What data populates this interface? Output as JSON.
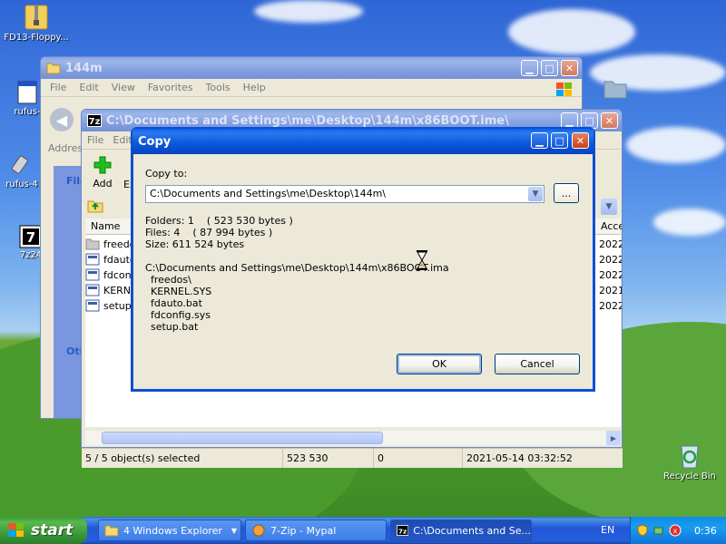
{
  "desktop_icons": {
    "floppy": "FD13-Floppy...",
    "rufus": "rufus-",
    "rufus4": "rufus-4",
    "sevenzip": "7z24",
    "recycle": "Recycle Bin"
  },
  "explorer": {
    "title": "144m",
    "menu": [
      "File",
      "Edit",
      "View",
      "Favorites",
      "Tools",
      "Help"
    ],
    "address_label": "Addres",
    "panel_file_label": "File",
    "panel_other_label": "Oth"
  },
  "sevenzip_window": {
    "title": "C:\\Documents and Settings\\me\\Desktop\\144m\\x86BOOT.ime\\",
    "menu": [
      "File",
      "Edit"
    ],
    "toolbar_add": "Add",
    "toolbar_extract": "Ex",
    "col_name": "Name",
    "col_accessed": "Acce",
    "rows": [
      {
        "name": "freedo",
        "date": "2022"
      },
      {
        "name": "fdauto",
        "date": "2022"
      },
      {
        "name": "fdconf",
        "date": "2022"
      },
      {
        "name": "KERNE",
        "date": "2021"
      },
      {
        "name": "setup",
        "date": "2022"
      }
    ],
    "status": {
      "selected": "5 / 5 object(s) selected",
      "size": "523 530",
      "packed": "0",
      "modified": "2021-05-14 03:32:52"
    }
  },
  "copy_dialog": {
    "title": "Copy",
    "copy_to_label": "Copy to:",
    "destination": "C:\\Documents and Settings\\me\\Desktop\\144m\\",
    "browse_label": "...",
    "folders": "Folders: 1    ( 523 530 bytes )",
    "files": "Files: 4    ( 87 994 bytes )",
    "size": "Size: 611 524 bytes",
    "source_path": "C:\\Documents and Settings\\me\\Desktop\\144m\\x86BOOT.ima",
    "items": [
      "freedos\\",
      "KERNEL.SYS",
      "fdauto.bat",
      "fdconfig.sys",
      "setup.bat"
    ],
    "ok_label": "OK",
    "cancel_label": "Cancel"
  },
  "taskbar": {
    "start_label": "start",
    "tasks": [
      {
        "label": "4 Windows Explorer"
      },
      {
        "label": "7-Zip - Mypal"
      },
      {
        "label": "C:\\Documents and Se..."
      }
    ],
    "language": "EN",
    "clock": "0:36"
  }
}
